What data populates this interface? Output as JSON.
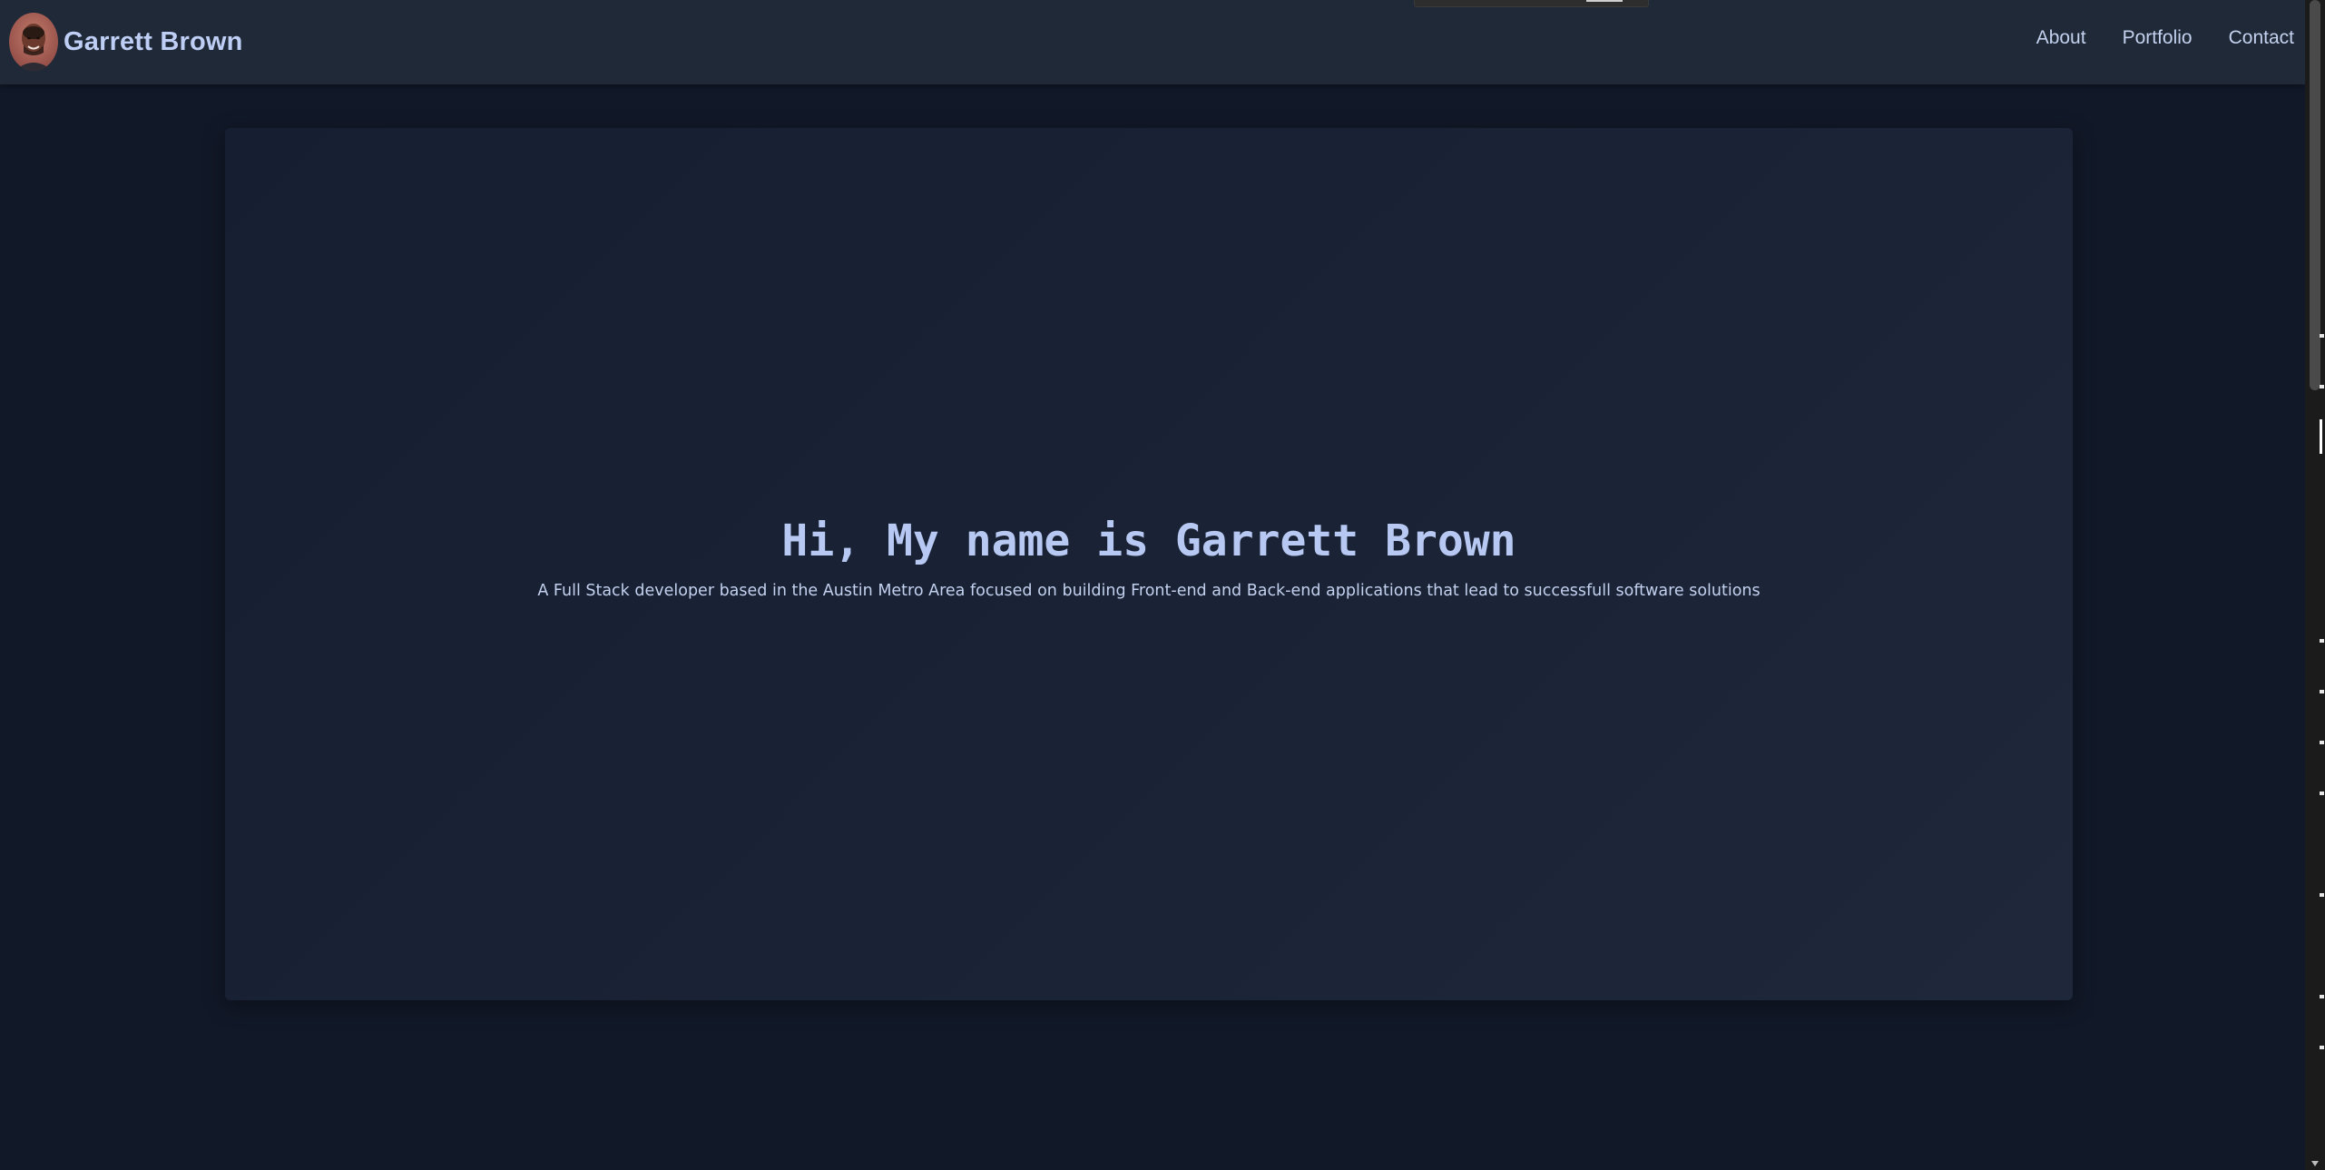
{
  "header": {
    "brand_name": "Garrett Brown",
    "nav": [
      {
        "label": "About"
      },
      {
        "label": "Portfolio"
      },
      {
        "label": "Contact"
      }
    ]
  },
  "hero": {
    "title": "Hi, My name is Garrett Brown",
    "subtitle": "A Full Stack developer based in the Austin Metro Area focused on building Front-end and Back-end applications that lead to successfull software solutions"
  },
  "colors": {
    "page_background": "#111827",
    "navbar_background": "#1f2937",
    "card_background": "#1a2335",
    "accent_text": "#b7c8f3"
  }
}
